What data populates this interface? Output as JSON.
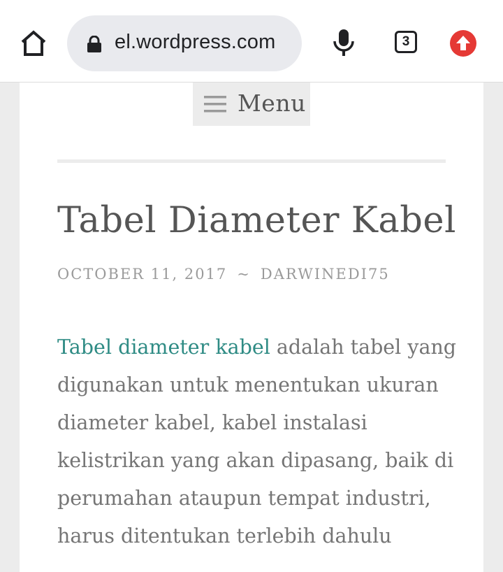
{
  "browser": {
    "url": "el.wordpress.com",
    "tab_count": "3",
    "icons": {
      "home": "home-icon",
      "lock": "lock-icon",
      "mic": "microphone-icon",
      "update": "update-arrow-icon"
    },
    "update_color": "#e53935"
  },
  "nav": {
    "menu_label": "Menu"
  },
  "post": {
    "title": "Tabel Diameter Kabel",
    "date": "OCTOBER 11, 2017",
    "separator": "~",
    "author": "DARWINEDI75",
    "link_text": "Tabel diameter kabel",
    "body_text": " adalah tabel yang digunakan untuk menentukan ukuran diameter kabel, kabel instalasi kelistrikan yang akan dipasang, baik di perumahan ataupun tempat industri, harus ditentukan terlebih dahulu",
    "link_color": "#2e8b84"
  }
}
